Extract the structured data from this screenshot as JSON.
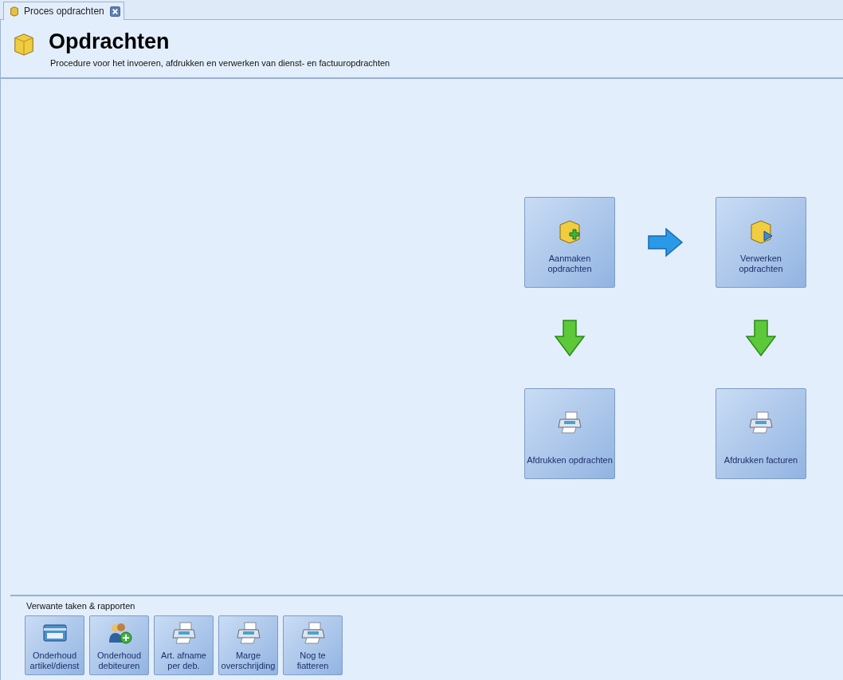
{
  "tabs": [
    {
      "label": "Proces opdrachten",
      "selected": true
    }
  ],
  "header": {
    "title": "Opdrachten",
    "subtitle": "Procedure voor het invoeren, afdrukken en verwerken van dienst- en factuuropdrachten"
  },
  "flow": {
    "tiles": [
      {
        "label": "Aanmaken\nopdrachten",
        "kind": "box-add"
      },
      {
        "label": "Verwerken\nopdrachten",
        "kind": "box-play"
      },
      {
        "label": "Afdrukken opdrachten",
        "kind": "printer"
      },
      {
        "label": "Afdrukken facturen",
        "kind": "printer"
      }
    ]
  },
  "related": {
    "title": "Verwante taken & rapporten",
    "items": [
      {
        "label": "Onderhoud\nartikel/dienst",
        "kind": "card"
      },
      {
        "label": "Onderhoud\ndebiteuren",
        "kind": "people-add"
      },
      {
        "label": "Art. afname\nper deb.",
        "kind": "printer"
      },
      {
        "label": "Marge\noverschrijding",
        "kind": "printer"
      },
      {
        "label": "Nog te\nfiatteren",
        "kind": "printer"
      }
    ]
  }
}
